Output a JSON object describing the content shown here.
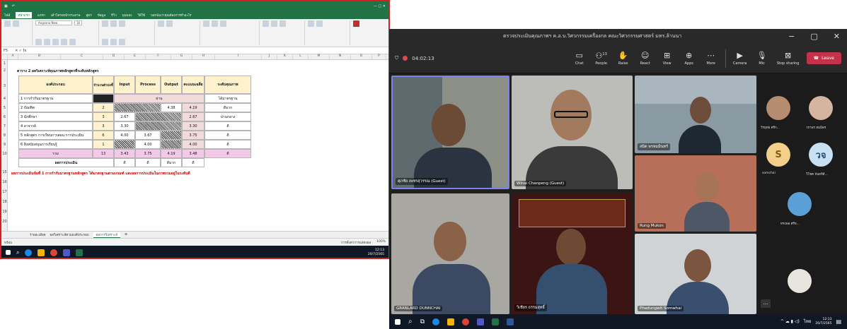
{
  "excel": {
    "menu_tabs": [
      "ไฟล์",
      "หน้าแรก",
      "แทรก",
      "เค้าโครงหน้ากระดาษ",
      "สูตร",
      "ข้อมูล",
      "รีวิว",
      "มุมมอง",
      "วิธีใช้",
      "บอกฉันว่าคุณต้องการทำอะไร"
    ],
    "font_name": "Angsana New",
    "font_size": "16",
    "name_box": "F5",
    "col_headers": [
      "A",
      "B",
      "C",
      "D",
      "E",
      "F",
      "G",
      "H",
      "I",
      "J",
      "K",
      "L",
      "M",
      "N",
      "O",
      "P"
    ],
    "row_nums": [
      "1",
      "2",
      "3",
      "4",
      "5",
      "6",
      "7",
      "8",
      "9",
      "10",
      "15",
      "16",
      "17",
      "18",
      "19",
      "20"
    ],
    "table_title": "ตาราง 2 ผลวิเคราะห์คุณภาพหลักสูตรที่ระดับหลักสูตร",
    "table_headers": [
      "องค์ประกอบ",
      "จำนวนตัวบ่งชี้",
      "Input",
      "Process",
      "Output",
      "คะแนนเฉลี่ย",
      "ระดับคุณภาพ"
    ],
    "rows": [
      {
        "c": "1 การกำกับมาตรฐาน",
        "e": "",
        "in": "",
        "pr": "ผ่าน",
        "out": "",
        "avg": "",
        "lvl": "ได้มาตรฐาน"
      },
      {
        "c": "2 บัณฑิต",
        "e": "2",
        "in": "",
        "pr": "",
        "out": "4.38",
        "avg": "4.19",
        "lvl": "ดีมาก"
      },
      {
        "c": "3 นักศึกษา",
        "e": "3",
        "in": "2.67",
        "pr": "",
        "out": "",
        "avg": "2.67",
        "lvl": "ปานกลาง"
      },
      {
        "c": "4 อาจารย์",
        "e": "3",
        "in": "3.30",
        "pr": "",
        "out": "",
        "avg": "3.30",
        "lvl": "ดี"
      },
      {
        "c": "5 หลักสูตร การเรียนการสอน การประเมิน",
        "e": "6",
        "in": "4.00",
        "pr": "3.67",
        "out": "",
        "avg": "3.75",
        "lvl": "ดี"
      },
      {
        "c": "6 สิ่งสนับสนุนการเรียนรู้",
        "e": "1",
        "in": "",
        "pr": "4.00",
        "out": "",
        "avg": "4.00",
        "lvl": "ดี"
      },
      {
        "c": "รวม",
        "e": "13",
        "in": "3.43",
        "pr": "3.75",
        "out": "4.19",
        "avg": "3.48",
        "lvl": "ดี"
      },
      {
        "c": "ผลการประเมิน",
        "e": "",
        "in": "ดี",
        "pr": "ดี",
        "out": "ดีมาก",
        "avg": "ดี",
        "lvl": ""
      }
    ],
    "note": "ผลการประเมินข้อที่ 1 การกำกับมาตรฐานหลักสูตร ได้มาตรฐานตามเกณฑ์ และผลการประเมินในภาพรวมอยู่ในระดับดี",
    "sheet_tabs": [
      "รายละเอียด",
      "ผลวิเคราะห์ตามองค์ประกอบ",
      "ผลการวิเคราะห์"
    ],
    "status_left": "พร้อม",
    "status_right": "การตั้งค่าการแสดงผล",
    "zoom": "100%",
    "clock": "12:13",
    "date": "20/7/2565",
    "accent": "#217346"
  },
  "teams": {
    "title": "ตรวจประเมินคุณภาพฯ ค.อ.บ.วิศวกรรมเครื่องกล คณะวิศวกรรมศาสตร์ มทร.ล้านนา",
    "timer": "04:02:13",
    "participants_count": "13",
    "tools": [
      "Chat",
      "People",
      "Raise",
      "React",
      "View",
      "Apps",
      "More",
      "Camera",
      "Mic",
      "Stop sharing"
    ],
    "leave_label": "Leave",
    "tiles": [
      "ศุภชัย เพชรสุวรรณ (Guest)",
      "Winai Chanpeng (Guest)",
      "สมิต พรหมมินทร์",
      "Rung Mukon",
      "GRANLARD DUNNCHAI",
      "วิเชียร ธรรมสุทธิ์",
      "Phadungwit Somwhai"
    ],
    "side_labels": [
      "วีรยุทธ ศรีก...",
      "วราพร สมมิตร",
      "somchai",
      "วิโชค จันทร์ดี...",
      "ทรงพล ศรีจ..."
    ],
    "avatar_initials": [
      "S",
      "วจ"
    ],
    "overflow": "...",
    "clock": "12:13",
    "date": "20/7/2565",
    "lang": "ไทย",
    "leave_color": "#c4314b"
  }
}
